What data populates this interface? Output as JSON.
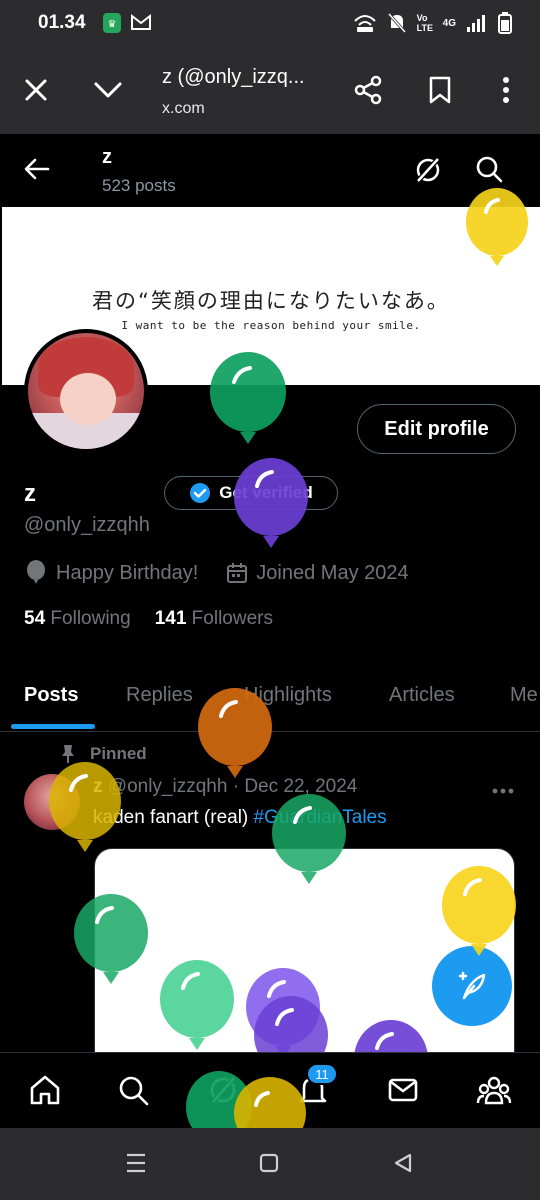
{
  "status": {
    "time": "01.34",
    "network": "4G",
    "volte": "Vo LTE"
  },
  "browser": {
    "title": "z (@only_izzq...",
    "url": "x.com"
  },
  "profile": {
    "name": "z",
    "posts_count": "523 posts",
    "banner_text_jp": "君の“笑顔の理由になりたいなあ。",
    "banner_text_en": "I want to be the reason behind your smile.",
    "edit_profile_label": "Edit profile",
    "get_verified_label": "Get verified",
    "handle": "@only_izzqhh",
    "birthday": "Happy Birthday!",
    "joined": "Joined May 2024",
    "following_count": "54",
    "following_label": "Following",
    "followers_count": "141",
    "followers_label": "Followers"
  },
  "tabs": [
    {
      "label": "Posts",
      "active": true
    },
    {
      "label": "Replies"
    },
    {
      "label": "Highlights"
    },
    {
      "label": "Articles"
    },
    {
      "label": "Me"
    }
  ],
  "post": {
    "pinned_label": "Pinned",
    "author_name": "z",
    "author_handle": "@only_izzqhh",
    "separator": "·",
    "date": "Dec 22, 2024",
    "text": "kaden fanart (real) ",
    "hashtag": "#GuardianTales"
  },
  "nav": {
    "notifications_badge": "11"
  },
  "colors": {
    "accent": "#1d9bf0",
    "background": "#000000",
    "muted": "#71767b"
  }
}
